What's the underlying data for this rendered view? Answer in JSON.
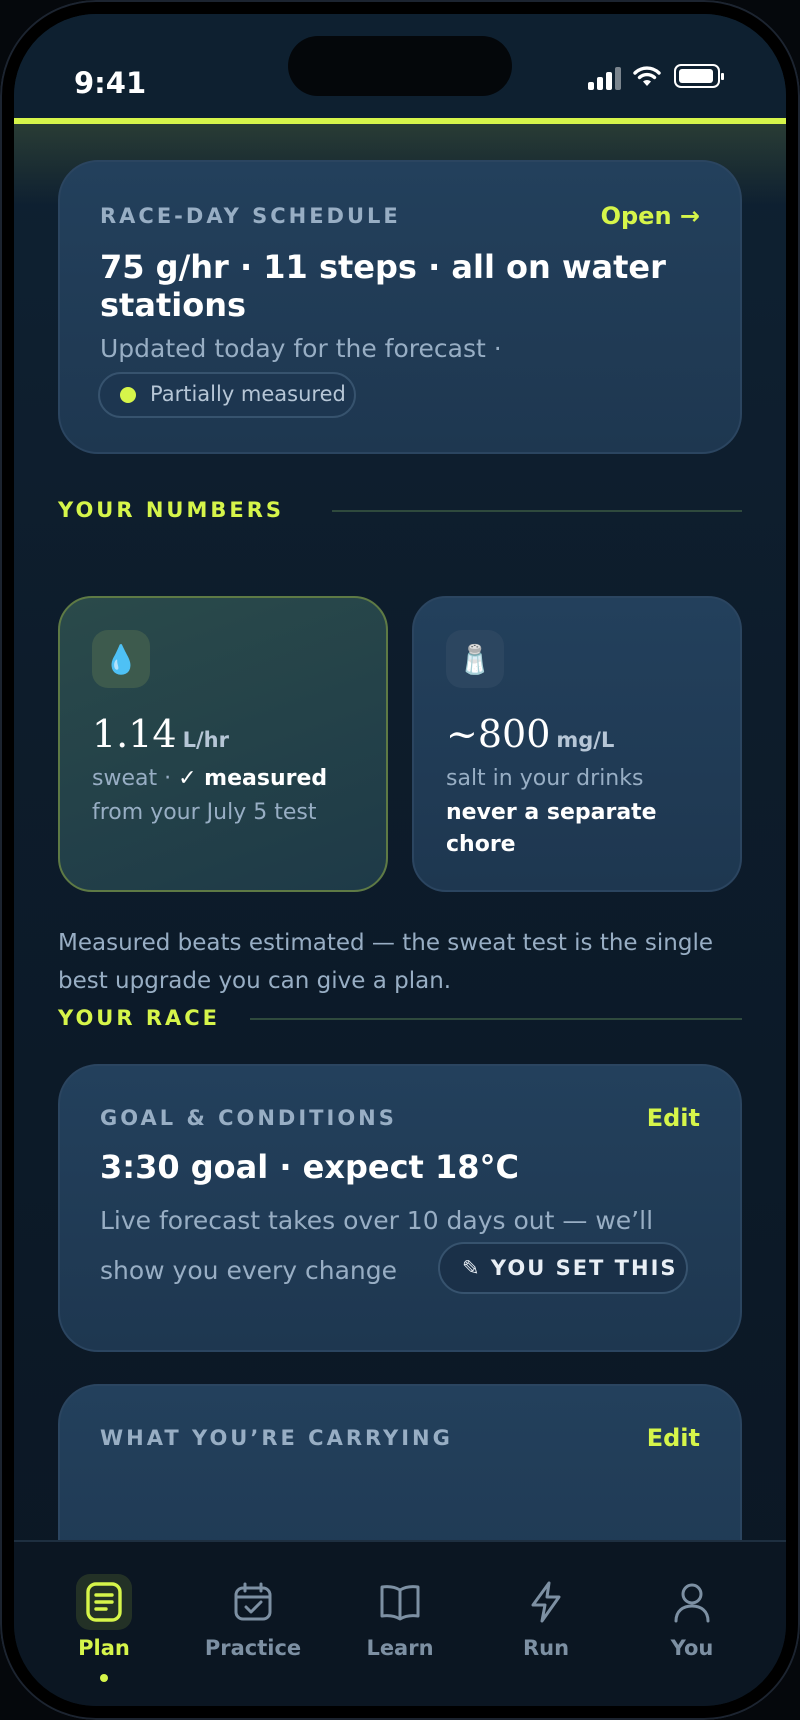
{
  "status_bar": {
    "time": "9:41"
  },
  "schedule_card": {
    "label": "RACE-DAY SCHEDULE",
    "action": "Open →",
    "title": "75 g/hr · 11 steps · all on water stations",
    "subtitle": "Updated today for the forecast ·",
    "pill": "Partially measured"
  },
  "numbers_section": {
    "label": "YOUR NUMBERS"
  },
  "sweat_metric": {
    "icon": "💧",
    "value": "1.14",
    "unit": "L/hr",
    "label_prefix": "sweat ·",
    "label_strong": "✓ measured",
    "detail": "from your July 5 test"
  },
  "salt_metric": {
    "icon": "🧂",
    "value": "~800",
    "unit": "mg/L",
    "label": "salt in your drinks",
    "detail_line1": "never a separate",
    "detail_line2": "chore"
  },
  "note": "Measured beats estimated — the sweat test is the single best upgrade you can give a plan.",
  "race_section": {
    "label": "YOUR RACE"
  },
  "goal_card": {
    "label": "GOAL & CONDITIONS",
    "action": "Edit",
    "title": "3:30 goal · expect 18°C",
    "subtitle_line1": "Live forecast takes over 10 days out — we’ll",
    "subtitle_line2": "show you every change",
    "pill": "✎ YOU SET THIS"
  },
  "carrying_card": {
    "label": "WHAT YOU’RE CARRYING",
    "action": "Edit"
  },
  "tabs": [
    {
      "label": "Plan",
      "icon": "plan-icon",
      "active": true
    },
    {
      "label": "Practice",
      "icon": "calendar-check-icon",
      "active": false
    },
    {
      "label": "Learn",
      "icon": "book-icon",
      "active": false
    },
    {
      "label": "Run",
      "icon": "lightning-icon",
      "active": false
    },
    {
      "label": "You",
      "icon": "person-icon",
      "active": false
    }
  ],
  "colors": {
    "accent": "#d6f54a",
    "background": "#0d1c2b",
    "card": "#23405c",
    "muted_text": "#98aec4"
  }
}
